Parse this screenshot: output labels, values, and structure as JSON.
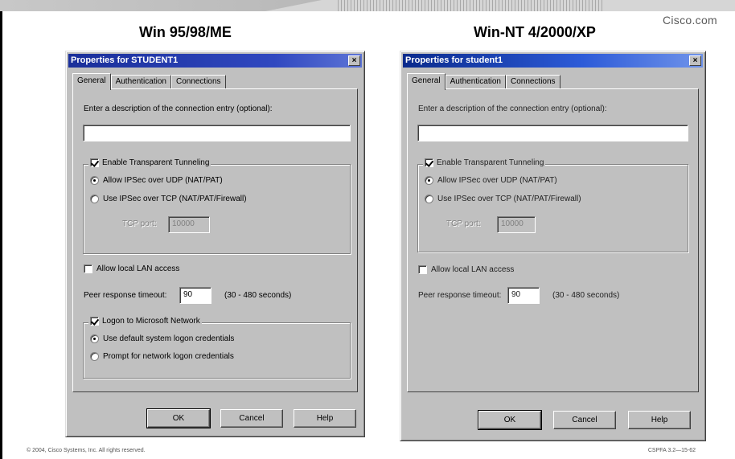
{
  "slide": {
    "brand": "Cisco.com",
    "heading_left": "Win 95/98/ME",
    "heading_right": "Win-NT 4/2000/XP",
    "footer_left": "© 2004, Cisco Systems, Inc. All rights reserved.",
    "footer_right": "CSPFA 3.2—15-62"
  },
  "dialog_left": {
    "title": "Properties for STUDENT1",
    "close": "×",
    "tabs": [
      "General",
      "Authentication",
      "Connections"
    ],
    "description_label": "Enter a description of the connection entry (optional):",
    "description_value": "",
    "transparent_tunneling": "Enable Transparent Tunneling",
    "ipsec_udp": "Allow IPSec over UDP (NAT/PAT)",
    "ipsec_tcp": "Use IPSec over TCP (NAT/PAT/Firewall)",
    "tcp_port_label": "TCP port:",
    "tcp_port_value": "10000",
    "allow_lan": "Allow local LAN access",
    "peer_timeout_label": "Peer response timeout:",
    "peer_timeout_value": "90",
    "peer_timeout_range": "(30 - 480 seconds)",
    "logon_ms": "Logon to Microsoft Network",
    "logon_default": "Use default system logon credentials",
    "logon_prompt": "Prompt for network logon credentials",
    "ok": "OK",
    "cancel": "Cancel",
    "help": "Help"
  },
  "dialog_right": {
    "title": "Properties for student1",
    "close": "×",
    "tabs": [
      "General",
      "Authentication",
      "Connections"
    ],
    "description_label": "Enter a description of the connection entry (optional):",
    "description_value": "",
    "transparent_tunneling": "Enable Transparent Tunneling",
    "ipsec_udp": "Allow IPSec over UDP (NAT/PAT)",
    "ipsec_tcp": "Use IPSec over TCP (NAT/PAT/Firewall)",
    "tcp_port_label": "TCP port:",
    "tcp_port_value": "10000",
    "allow_lan": "Allow local LAN access",
    "peer_timeout_label": "Peer response timeout:",
    "peer_timeout_value": "90",
    "peer_timeout_range": "(30 - 480 seconds)",
    "ok": "OK",
    "cancel": "Cancel",
    "help": "Help"
  }
}
